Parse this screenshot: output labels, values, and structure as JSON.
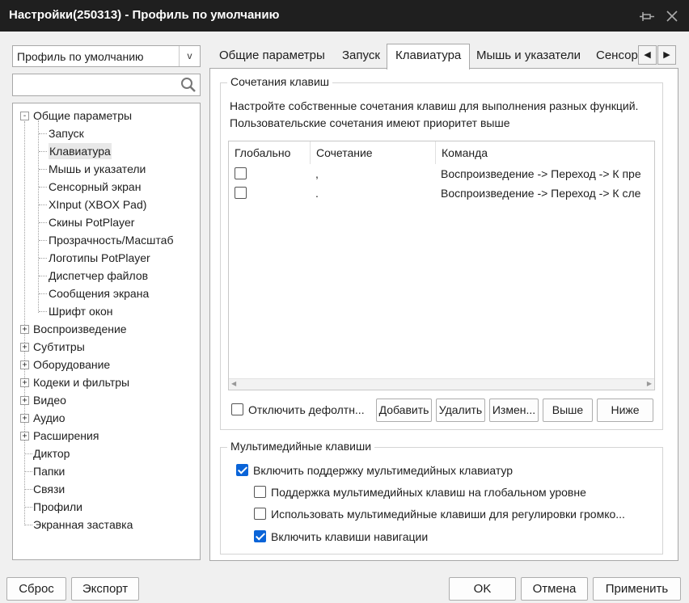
{
  "window": {
    "title": "Настройки(250313) - Профиль по умолчанию"
  },
  "profile": {
    "selected": "Профиль по умолчанию"
  },
  "search": {
    "value": "",
    "placeholder": ""
  },
  "tree": {
    "root_expanded": "Общие параметры",
    "children": [
      "Запуск",
      "Клавиатура",
      "Мышь и указатели",
      "Сенсорный экран",
      "XInput (XBOX Pad)",
      "Скины PotPlayer",
      "Прозрачность/Масштаб",
      "Логотипы PotPlayer",
      "Диспетчер файлов",
      "Сообщения экрана",
      "Шрифт окон"
    ],
    "collapsed": [
      "Воспроизведение",
      "Субтитры",
      "Оборудование",
      "Кодеки и фильтры",
      "Видео",
      "Аудио",
      "Расширения"
    ],
    "leaves": [
      "Диктор",
      "Папки",
      "Связи",
      "Профили",
      "Экранная заставка"
    ],
    "selected": "Клавиатура"
  },
  "tabs": [
    "Общие параметры",
    "Запуск",
    "Клавиатура",
    "Мышь и указатели",
    "Сенсор"
  ],
  "active_tab": "Клавиатура",
  "hotkeys": {
    "group_title": "Сочетания клавиш",
    "description": "Настройте собственные сочетания клавиш для выполнения разных функций. Пользовательские сочетания имеют приоритет выше",
    "columns": [
      "Глобально",
      "Сочетание",
      "Команда"
    ],
    "rows": [
      {
        "global": false,
        "combo": ",",
        "command": "Воспроизведение -> Переход -> К пре"
      },
      {
        "global": false,
        "combo": ".",
        "command": "Воспроизведение -> Переход -> К сле"
      }
    ],
    "disable_default_label": "Отключить дефолтн...",
    "disable_default_checked": false,
    "buttons": {
      "add": "Добавить",
      "remove": "Удалить",
      "edit": "Измен...",
      "up": "Выше",
      "down": "Ниже"
    }
  },
  "multimedia": {
    "group_title": "Мультимедийные клавиши",
    "options": [
      {
        "label": "Включить поддержку мультимедийных клавиатур",
        "checked": true
      },
      {
        "label": "Поддержка мультимедийных клавиш на глобальном уровне",
        "checked": false
      },
      {
        "label": "Использовать мультимедийные клавиши для регулировки громко...",
        "checked": false
      },
      {
        "label": "Включить клавиши навигации",
        "checked": true
      }
    ]
  },
  "footer": {
    "reset": "Сброс",
    "export": "Экспорт",
    "ok": "OK",
    "cancel": "Отмена",
    "apply": "Применить"
  },
  "colors": {
    "titlebar": "#1f1f1f",
    "accent": "#0a64d8",
    "background": "#f0f0f0"
  }
}
